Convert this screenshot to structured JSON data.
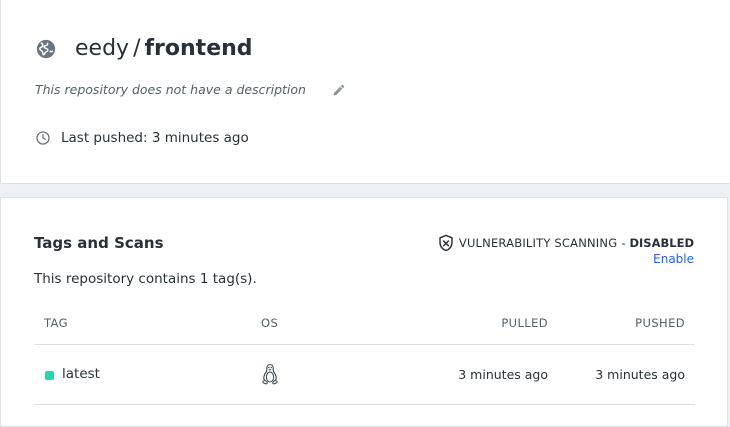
{
  "repo": {
    "owner": "eedy",
    "separator": "/",
    "name": "frontend",
    "description": "This repository does not have a description",
    "last_pushed": "Last pushed: 3 minutes ago",
    "icons": {
      "visibility": "globe-icon",
      "edit": "pencil-icon",
      "time": "clock-icon"
    }
  },
  "tags_section": {
    "title": "Tags and Scans",
    "summary": "This repository contains 1 tag(s).",
    "vulnerability": {
      "label": "VULNERABILITY SCANNING",
      "dash": "-",
      "status": "DISABLED",
      "enable_label": "Enable",
      "icon": "shield-x-icon"
    },
    "columns": [
      "TAG",
      "OS",
      "PULLED",
      "PUSHED"
    ],
    "rows": [
      {
        "tag": "latest",
        "os": "linux",
        "pulled": "3 minutes ago",
        "pushed": "3 minutes ago",
        "status_color": "#2bd4a8"
      }
    ]
  },
  "colors": {
    "accent": "#1d63ed",
    "text": "#27313a",
    "muted": "#51606b",
    "border": "#dde2e6",
    "background": "#eef1f3"
  }
}
